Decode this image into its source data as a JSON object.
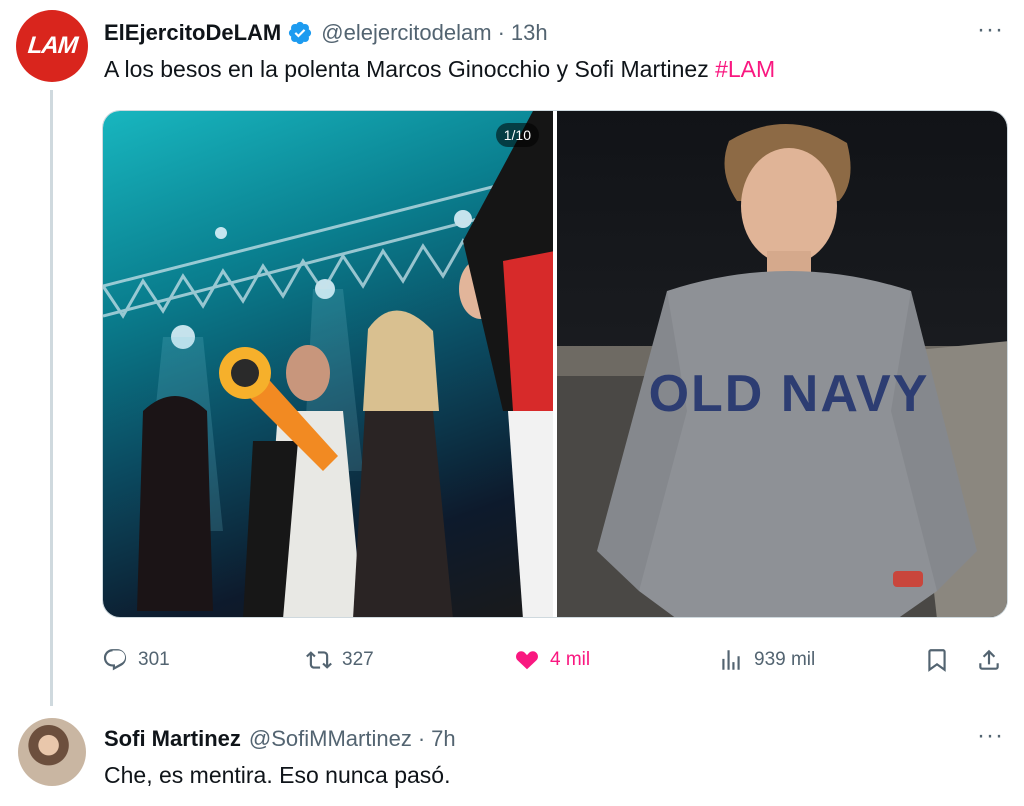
{
  "main_tweet": {
    "avatar_text": "LAM",
    "display_name": "ElEjercitoDeLAM",
    "handle": "@elejercitodelam",
    "separator": "·",
    "time": "13h",
    "more": "···",
    "text": "A los besos en la polenta Marcos Ginocchio y Sofi Martinez ",
    "hashtag": "#LAM",
    "media": {
      "counter": "1/10",
      "photo_left": "party-photo",
      "photo_right": "portrait-photo",
      "sweatshirt_text": "OLD NAVY"
    },
    "actions": {
      "replies": "301",
      "retweets": "327",
      "likes": "4 mil",
      "views": "939 mil"
    }
  },
  "reply_tweet": {
    "display_name": "Sofi Martinez",
    "handle": "@SofiMMartinez",
    "separator": "·",
    "time": "7h",
    "more": "···",
    "text": "Che, es mentira. Eso nunca pasó."
  },
  "colors": {
    "accent_pink": "#f91880",
    "verified_blue": "#1d9bf0",
    "lam_red": "#d9251d",
    "secondary_text": "#536471"
  },
  "icons": [
    "verified-badge-icon",
    "reply-icon",
    "retweet-icon",
    "heart-icon",
    "views-icon",
    "bookmark-icon",
    "share-icon",
    "more-icon"
  ]
}
